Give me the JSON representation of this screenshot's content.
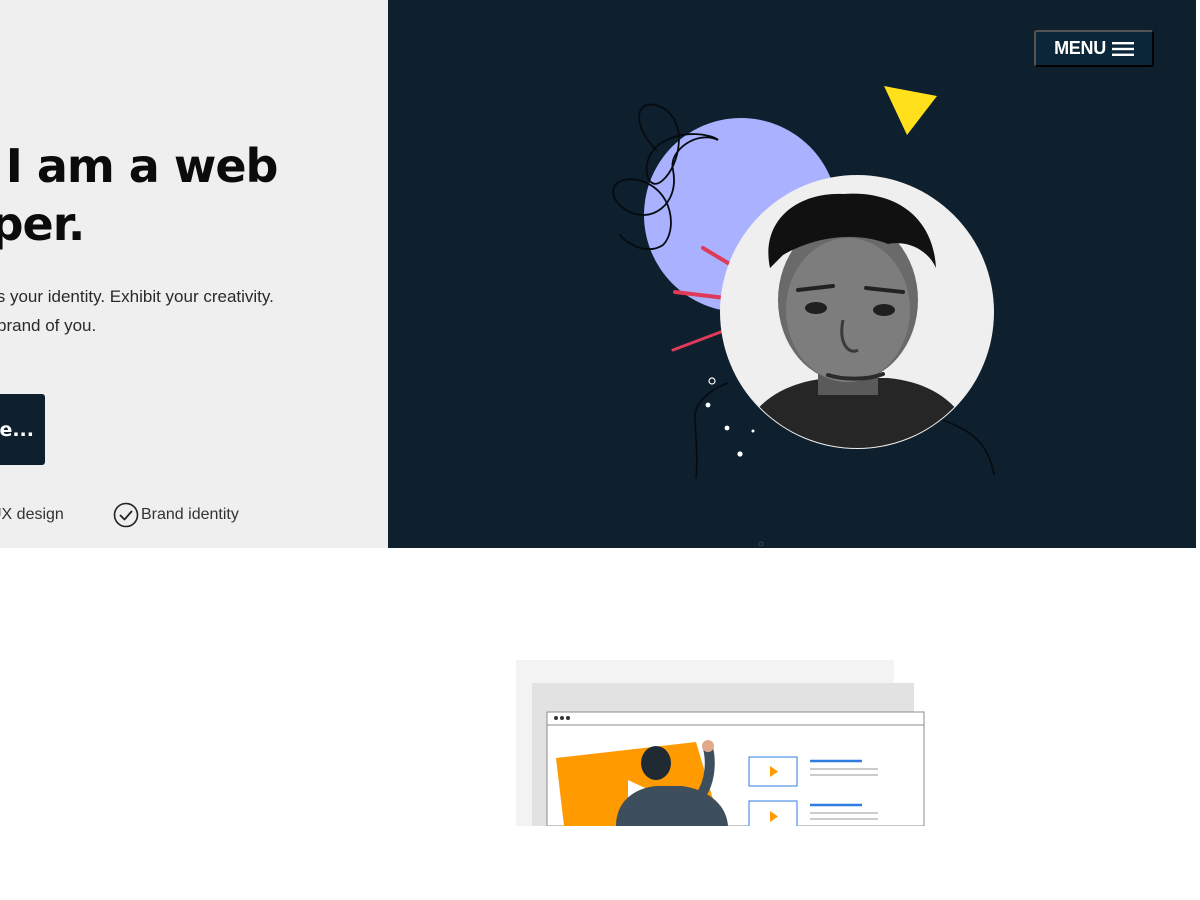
{
  "hero": {
    "headline_line1": "e, I am a web",
    "headline_line2": "oper.",
    "subtext_line1": "ts your identity. Exhibit your creativity.",
    "subtext_line2": "brand of you.",
    "cta_label": "ne...",
    "skills": [
      {
        "label": "UX design"
      },
      {
        "label": "Brand identity"
      }
    ],
    "menu_label": "MENU"
  },
  "colors": {
    "dark_navy": "#0e1f2e",
    "light_bg": "#efefef",
    "lavender": "#aab2ff",
    "yellow": "#ffe01b",
    "red_accent": "#e03a5a",
    "orange": "#ff9a00",
    "blue_accent": "#2f7de1"
  },
  "icons": [
    "check-circle-icon",
    "hamburger-menu-icon"
  ]
}
